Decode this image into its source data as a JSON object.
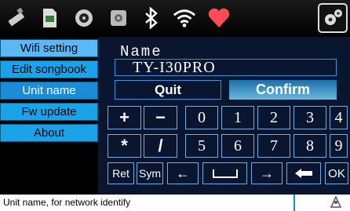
{
  "top_icons": [
    "usb-icon",
    "sd-card-icon",
    "disc-icon",
    "hdd-icon",
    "bluetooth-icon",
    "wifi-icon",
    "heart-icon",
    "settings-gears-icon"
  ],
  "menu": {
    "items": [
      {
        "label": "Wifi setting",
        "state": "highlight"
      },
      {
        "label": "Edit songbook",
        "state": "normal"
      },
      {
        "label": "Unit name",
        "state": "active"
      },
      {
        "label": "Fw update",
        "state": "normal"
      },
      {
        "label": "About",
        "state": "normal"
      }
    ]
  },
  "form": {
    "label": "Name",
    "value": "TY-I30PRO",
    "quit_label": "Quit",
    "confirm_label": "Confirm"
  },
  "keypad": {
    "row1": [
      "+",
      "−",
      "0",
      "1",
      "2",
      "3",
      "4"
    ],
    "row2": [
      "*",
      "/",
      "5",
      "6",
      "7",
      "8",
      "9"
    ],
    "row3": [
      "Ret",
      "Sym",
      "←",
      "␣",
      "→",
      "backspace",
      "OK"
    ]
  },
  "status": {
    "text": "Unit name, for network identify"
  },
  "colors": {
    "menu_bg": "#1aa3e8",
    "menu_active": "#1a8cd8",
    "panel_bg": "#0a1630",
    "confirm_bg": "#3a90c8"
  }
}
